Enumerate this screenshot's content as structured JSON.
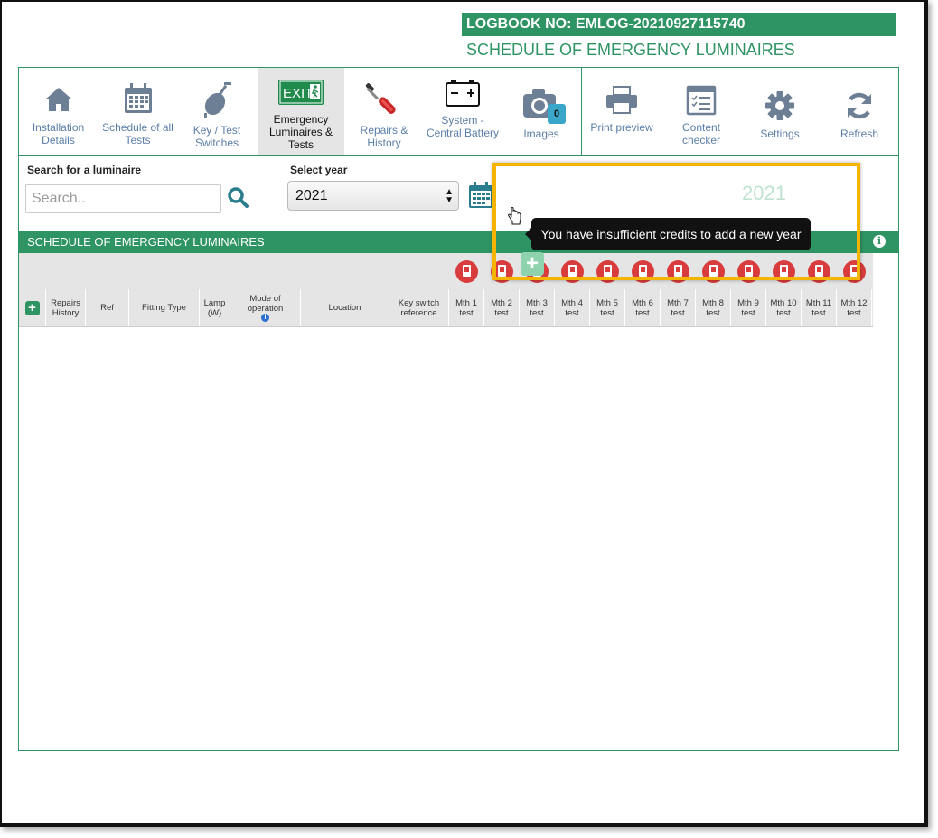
{
  "header": {
    "logbook": "LOGBOOK NO: EMLOG-20210927115740",
    "subtitle": "SCHEDULE OF EMERGENCY LUMINAIRES"
  },
  "toolbar": {
    "items": [
      {
        "label": "Installation Details",
        "icon": "house-icon"
      },
      {
        "label": "Schedule of all Tests",
        "icon": "calendar-icon"
      },
      {
        "label": "Key / Test Switches",
        "icon": "key-switch-icon"
      },
      {
        "label": "Emergency Luminaires & Tests",
        "icon": "exit-sign-icon",
        "active": true
      },
      {
        "label": "Repairs & History",
        "icon": "screwdriver-icon"
      },
      {
        "label": "System - Central Battery",
        "icon": "battery-icon"
      },
      {
        "label": "Images",
        "icon": "camera-icon",
        "badge": "0"
      },
      {
        "label": "Print preview",
        "icon": "printer-icon"
      },
      {
        "label": "Content checker",
        "icon": "checklist-icon"
      },
      {
        "label": "Settings",
        "icon": "gear-icon"
      },
      {
        "label": "Refresh",
        "icon": "refresh-icon"
      }
    ],
    "exit_sign_text": "EXIT"
  },
  "search": {
    "label": "Search for a luminaire",
    "placeholder": "Search.."
  },
  "year_select": {
    "label": "Select year",
    "value": "2021",
    "ghost_year": "2021"
  },
  "tooltip": "You have insufficient credits to add a new year",
  "band_title": "SCHEDULE OF EMERGENCY LUMINAIRES",
  "table": {
    "columns": [
      "Repairs History",
      "Ref",
      "Fitting Type",
      "Lamp (W)",
      "Mode of operation",
      "Location",
      "Key switch reference",
      "Mth 1 test",
      "Mth 2 test",
      "Mth 3 test",
      "Mth 4 test",
      "Mth 5 test",
      "Mth 6 test",
      "Mth 7 test",
      "Mth 8 test",
      "Mth 9 test",
      "Mth 10 test",
      "Mth 11 test",
      "Mth 12 test"
    ]
  },
  "colors": {
    "brand_green": "#2f9463",
    "highlight": "#f4b400",
    "pdf_red": "#d93c3c"
  }
}
